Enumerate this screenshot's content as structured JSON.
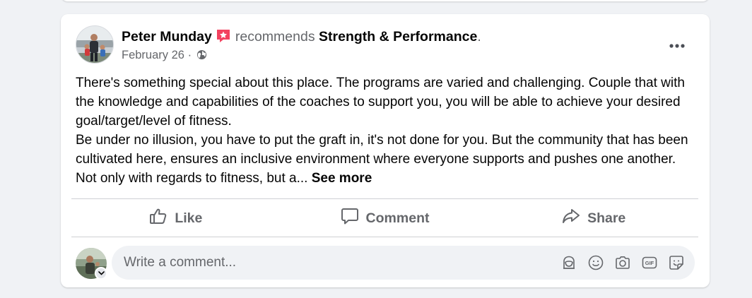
{
  "post": {
    "author": "Peter Munday",
    "recommends_text": "recommends",
    "page_name": "Strength & Performance",
    "trailing_period": ".",
    "date": "February 26",
    "meta_separator": "·",
    "body_paragraph_1": "There's something special about this place. The programs are varied and challenging. Couple that with the knowledge and capabilities of the coaches to support you, you will be able to achieve your desired goal/target/level of fitness.",
    "body_paragraph_2": "Be under no illusion, you have to put the graft in, it's not done for you. But the community that has been cultivated here, ensures an inclusive environment where everyone supports and pushes one another. Not only with regards to fitness, but a...",
    "see_more": "See more"
  },
  "actions": {
    "like_label": "Like",
    "comment_label": "Comment",
    "share_label": "Share"
  },
  "composer": {
    "placeholder": "Write a comment...",
    "tools": [
      "avatar-sticker-icon",
      "emoji-icon",
      "camera-icon",
      "gif-icon",
      "sticker-icon"
    ]
  },
  "colors": {
    "background": "#f0f2f5",
    "card": "#ffffff",
    "primary_text": "#050505",
    "secondary_text": "#65676b",
    "recommend_badge": "#f3425f",
    "divider": "#ced0d4"
  }
}
